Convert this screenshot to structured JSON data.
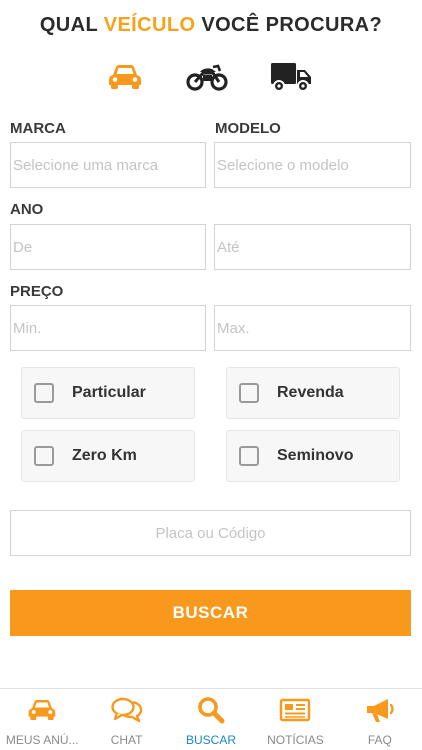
{
  "header": {
    "title_pre": "QUAL ",
    "title_accent": "VEÍCULO",
    "title_post": " VOCÊ PROCURA?"
  },
  "vehicle_types": [
    {
      "name": "car",
      "icon": "car-icon",
      "selected": true
    },
    {
      "name": "motorcycle",
      "icon": "motorcycle-icon",
      "selected": false
    },
    {
      "name": "truck",
      "icon": "truck-icon",
      "selected": false
    }
  ],
  "form": {
    "marca_label": "MARCA",
    "marca_placeholder": "Selecione uma marca",
    "modelo_label": "MODELO",
    "modelo_placeholder": "Selecione o modelo",
    "ano_label": "ANO",
    "ano_de_placeholder": "De",
    "ano_ate_placeholder": "Até",
    "preco_label": "PREÇO",
    "preco_min_placeholder": "Min.",
    "preco_max_placeholder": "Max.",
    "checkboxes": [
      {
        "label": "Particular",
        "checked": false
      },
      {
        "label": "Revenda",
        "checked": false
      },
      {
        "label": "Zero Km",
        "checked": false
      },
      {
        "label": "Seminovo",
        "checked": false
      }
    ],
    "placa_placeholder": "Placa ou Código",
    "submit_label": "BUSCAR"
  },
  "tabbar": {
    "items": [
      {
        "label": "MEUS ANÚ...",
        "icon": "car-icon",
        "active": false
      },
      {
        "label": "CHAT",
        "icon": "chat-icon",
        "active": false
      },
      {
        "label": "BUSCAR",
        "icon": "search-icon",
        "active": true
      },
      {
        "label": "NOTÍCIAS",
        "icon": "newspaper-icon",
        "active": false
      },
      {
        "label": "FAQ",
        "icon": "megaphone-icon",
        "active": false
      }
    ]
  },
  "colors": {
    "accent": "#f8991d",
    "active_tab": "#1788c8",
    "text_dark": "#2b2b2b"
  }
}
